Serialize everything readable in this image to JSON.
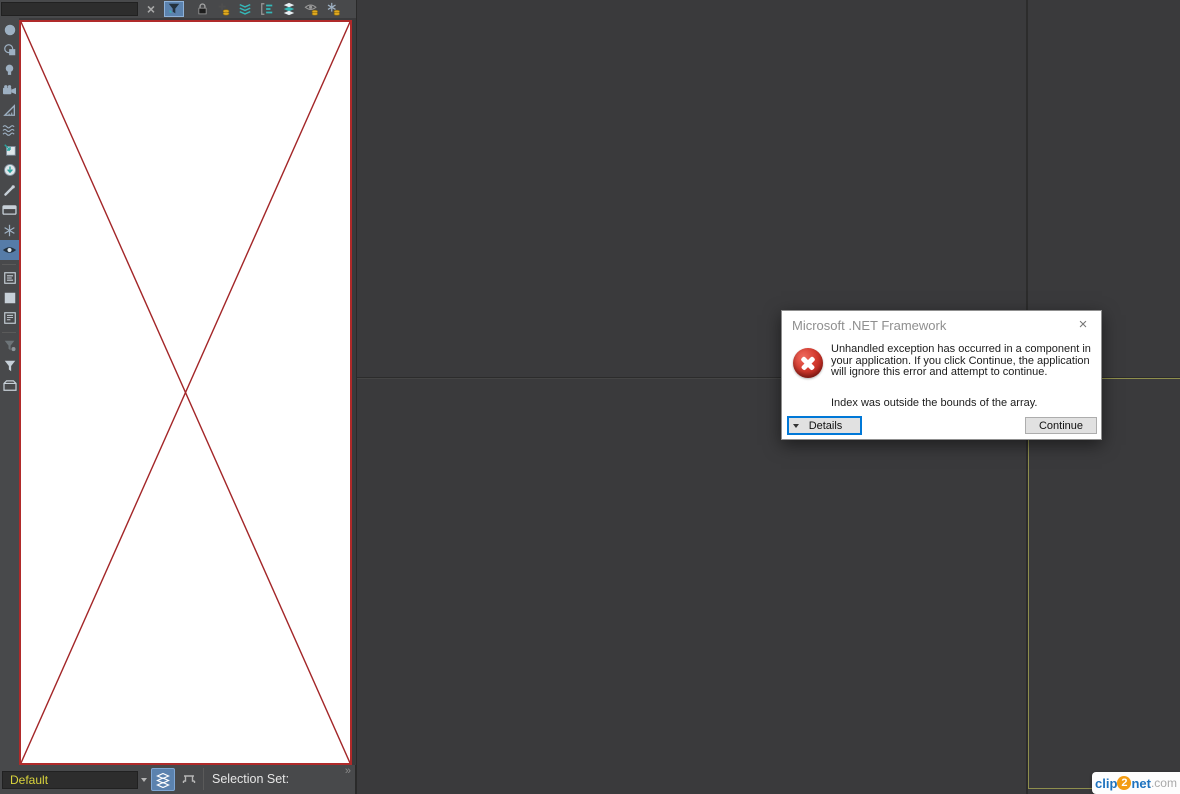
{
  "top_toolbar": {
    "search": {
      "value": "",
      "placeholder": ""
    },
    "clear_glyph": "×",
    "buttons": [
      {
        "name": "filter-selection",
        "active": true
      },
      {
        "name": "lock-cell-editing",
        "active": false
      },
      {
        "name": "pick-add-objects",
        "active": false
      },
      {
        "name": "select-children",
        "active": false
      },
      {
        "name": "sync-selection",
        "active": false
      },
      {
        "name": "layer-stack",
        "active": false
      },
      {
        "name": "hide-objects",
        "active": false
      },
      {
        "name": "freeze-objects",
        "active": false
      }
    ]
  },
  "left_toolbar": {
    "buttons": [
      {
        "name": "display-geometry"
      },
      {
        "name": "display-shapes"
      },
      {
        "name": "display-lights"
      },
      {
        "name": "display-cameras"
      },
      {
        "name": "display-helpers"
      },
      {
        "name": "display-space-warps"
      },
      {
        "name": "display-xrefs"
      },
      {
        "name": "display-imports"
      },
      {
        "name": "display-bones"
      },
      {
        "name": "display-containers"
      },
      {
        "name": "display-frozen",
        "": ""
      },
      {
        "name": "display-hidden",
        "active": true
      },
      {
        "name": "list-view-a"
      },
      {
        "name": "blank-view"
      },
      {
        "name": "list-view-b"
      },
      {
        "name": "filter-with-options"
      },
      {
        "name": "filter-plain"
      },
      {
        "name": "container-basket"
      }
    ]
  },
  "broken_panel": {
    "note": "white area crossed by red X placeholder"
  },
  "bottom_bar": {
    "layer_field_value": "Default",
    "selection_set_label": "Selection Set:",
    "overflow_indicator": "»"
  },
  "dialog": {
    "title": "Microsoft .NET Framework",
    "close_glyph": "×",
    "message": "Unhandled exception has occurred in a component in your application. If you click Continue, the application will ignore this error and attempt to continue.",
    "detail_message": "Index was outside the bounds of the array.",
    "details_button_label": "Details",
    "continue_button_label": "Continue"
  },
  "watermark": {
    "part1": "clip",
    "part2": "2",
    "part3": "net",
    "part4": ".com"
  },
  "colors": {
    "accent_blue": "#5b82ae",
    "panel_bg": "#48494b",
    "viewport_bg": "#3a3a3c",
    "red_border": "#b02a2a",
    "diagonal_red": "#a32628",
    "layer_text_yellow": "#d9d33c",
    "viewport_rect_olive": "#8e8e4d",
    "coin_yellow": "#e0a81f",
    "icon_teal": "#35b8b8",
    "icon_gray": "#9db0c2",
    "focus_blue": "#0078d7"
  }
}
